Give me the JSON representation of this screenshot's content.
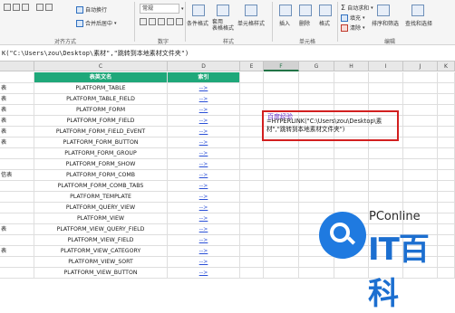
{
  "ribbon": {
    "auto_wrap": "自动换行",
    "merge_center": "合并后居中",
    "general": "常规",
    "conditional_format": "条件格式",
    "format_as_table": "套用\n表格格式",
    "cell_styles": "单元格样式",
    "insert": "插入",
    "delete": "删除",
    "format": "格式",
    "autosum": "自动求和",
    "fill": "填充",
    "clear": "清除",
    "sort_filter": "排序和筛选",
    "find_select": "查找和选择",
    "groups": {
      "alignment": "对齐方式",
      "number": "数字",
      "styles": "样式",
      "cells": "单元格",
      "editing": "编辑"
    }
  },
  "formula_bar": {
    "text": "K(\"C:\\Users\\zou\\Desktop\\素材\",\"跳转到本地素材文件夹\")"
  },
  "columns": {
    "C": "C",
    "D": "D",
    "E": "E",
    "F": "F",
    "G": "G",
    "H": "H",
    "I": "I",
    "J": "J",
    "K": "K"
  },
  "table": {
    "headers": {
      "name": "表英文名",
      "index": "索引"
    },
    "rows": [
      {
        "a": "表",
        "name": "PLATFORM_TABLE",
        "link": "-->"
      },
      {
        "a": "表",
        "name": "PLATFORM_TABLE_FIELD",
        "link": "-->"
      },
      {
        "a": "表",
        "name": "PLATFORM_FORM",
        "link": "-->"
      },
      {
        "a": "表",
        "name": "PLATFORM_FORM_FIELD",
        "link": "-->"
      },
      {
        "a": "表",
        "name": "PLATFORM_FORM_FIELD_EVENT",
        "link": "-->"
      },
      {
        "a": "表",
        "name": "PLATFORM_FORM_BUTTON",
        "link": "-->"
      },
      {
        "a": "",
        "name": "PLATFORM_FORM_GROUP",
        "link": "-->"
      },
      {
        "a": "",
        "name": "PLATFORM_FORM_SHOW",
        "link": "-->"
      },
      {
        "a": "信表",
        "name": "PLATFORM_FORM_COMB",
        "link": "-->"
      },
      {
        "a": "",
        "name": "PLATFORM_FORM_COMB_TABS",
        "link": "-->"
      },
      {
        "a": "",
        "name": "PLATFORM_TEMPLATE",
        "link": "-->"
      },
      {
        "a": "",
        "name": "PLATFORM_QUERY_VIEW",
        "link": "-->"
      },
      {
        "a": "",
        "name": "PLATFORM_VIEW",
        "link": "-->"
      },
      {
        "a": "表",
        "name": "PLATFORM_VIEW_QUERY_FIELD",
        "link": "-->"
      },
      {
        "a": "",
        "name": "PLATFORM_VIEW_FIELD",
        "link": "-->"
      },
      {
        "a": "表",
        "name": "PLATFORM_VIEW_CATEGORY",
        "link": "-->"
      },
      {
        "a": "",
        "name": "PLATFORM_VIEW_SORT",
        "link": "-->"
      },
      {
        "a": "",
        "name": "PLATFORM_VIEW_BUTTON",
        "link": "-->"
      }
    ]
  },
  "annotation": {
    "label": "百度经验",
    "formula": "=HYPERLINK(\"C:\\Users\\zou\\Desktop\\素材\",\"跳转到本地素材文件夹\")"
  },
  "watermark": {
    "small": "PConline",
    "big": "IT百科"
  },
  "colors": {
    "header_green": "#1fa87a",
    "link_blue": "#2a4fd6",
    "annotation_red": "#d21f1f",
    "label_purple": "#6c35c9",
    "watermark_blue": "#1c6fd0"
  }
}
